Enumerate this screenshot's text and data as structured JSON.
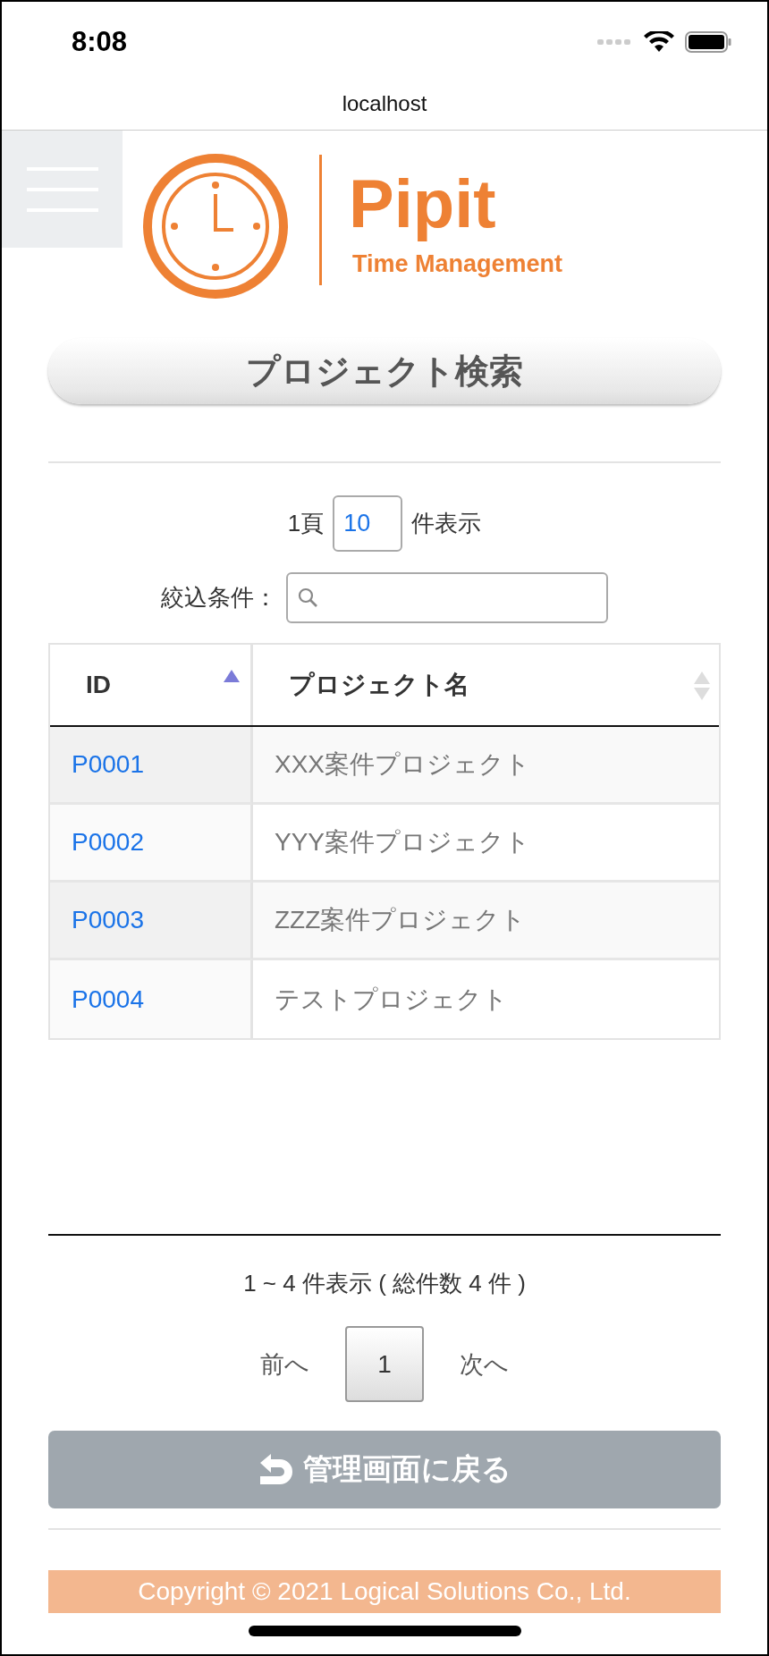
{
  "status_bar": {
    "time": "8:08"
  },
  "browser": {
    "url": "localhost"
  },
  "logo": {
    "name": "Pipit",
    "tagline": "Time Management"
  },
  "page_title": "プロジェクト検索",
  "page_length": {
    "prefix": "1頁",
    "value": "10",
    "suffix": "件表示"
  },
  "filter": {
    "label": "絞込条件："
  },
  "table": {
    "columns": [
      {
        "label": "ID",
        "sorted": true
      },
      {
        "label": "プロジェクト名",
        "sorted": false
      }
    ],
    "rows": [
      {
        "id": "P0001",
        "name": "XXX案件プロジェクト"
      },
      {
        "id": "P0002",
        "name": "YYY案件プロジェクト"
      },
      {
        "id": "P0003",
        "name": "ZZZ案件プロジェクト"
      },
      {
        "id": "P0004",
        "name": "テストプロジェクト"
      }
    ]
  },
  "summary": "1 ~ 4 件表示 ( 総件数 4 件 )",
  "pagination": {
    "previous": "前へ",
    "pages": [
      {
        "label": "1",
        "selected": true
      }
    ],
    "next": "次へ"
  },
  "back_button": "管理画面に戻る",
  "footer": "Copyright © 2021 Logical Solutions Co., Ltd."
}
